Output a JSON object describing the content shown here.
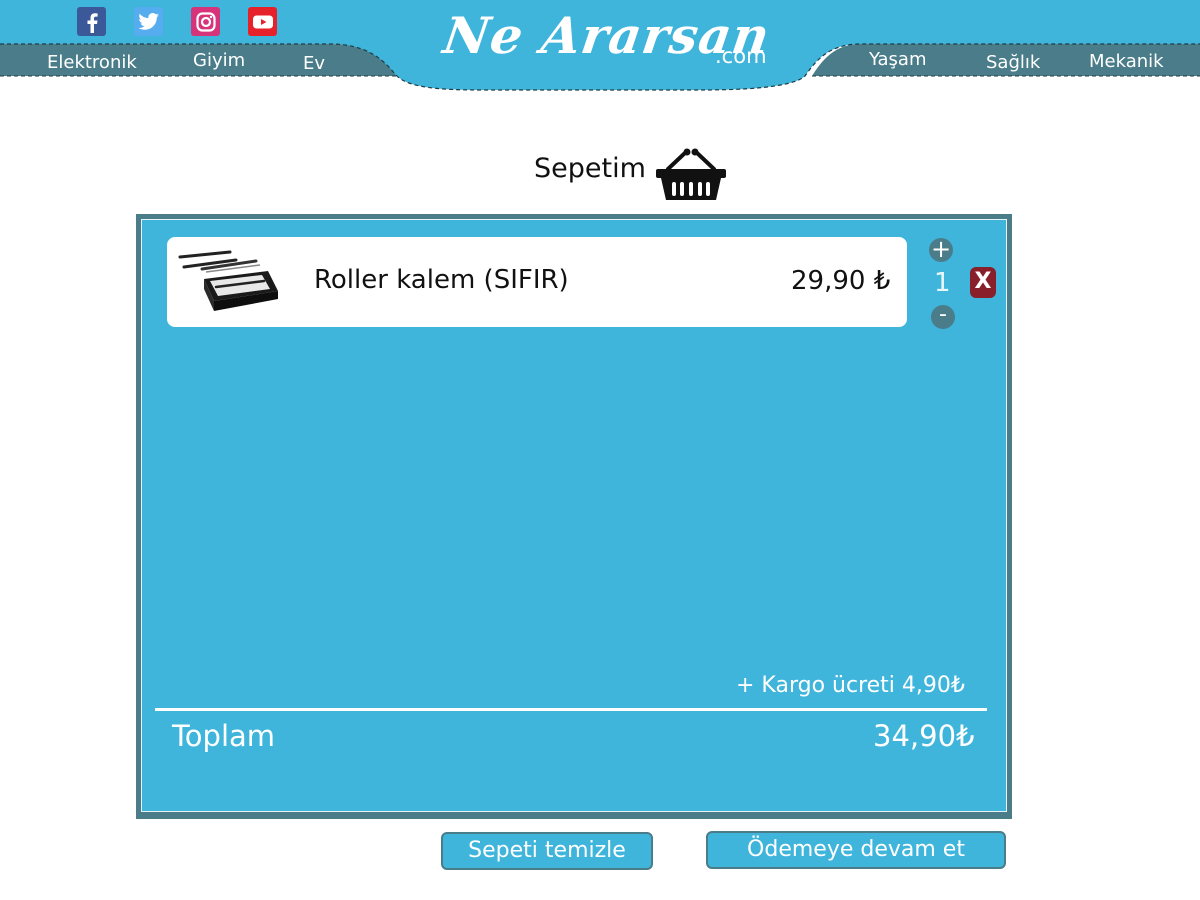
{
  "header": {
    "social": [
      {
        "icon": "facebook-icon",
        "color": "#3b5998"
      },
      {
        "icon": "twitter-icon",
        "color": "#55acee"
      },
      {
        "icon": "instagram-icon",
        "color": "#d6337a"
      },
      {
        "icon": "youtube-icon",
        "color": "#e62129"
      }
    ],
    "nav_left": [
      "Elektronik",
      "Giyim",
      "Ev"
    ],
    "nav_right": [
      "Yaşam",
      "Sağlık",
      "Mekanik"
    ],
    "logo_main": "Ne Ararsan",
    "logo_tld": ".com"
  },
  "cart": {
    "title": "Sepetim",
    "items": [
      {
        "name": "Roller kalem (SIFIR)",
        "price": "29,90 ₺",
        "quantity": "1"
      }
    ],
    "qty_plus": "+",
    "qty_minus": "-",
    "remove_label": "X",
    "shipping": "+ Kargo ücreti 4,90₺",
    "total_label": "Toplam",
    "total_value": "34,90₺"
  },
  "actions": {
    "clear_label": "Sepeti temizle",
    "checkout_label": "Ödemeye devam et"
  },
  "colors": {
    "primary": "#3fb5dc",
    "dark": "#4a7d89",
    "remove": "#8a1f2c"
  }
}
